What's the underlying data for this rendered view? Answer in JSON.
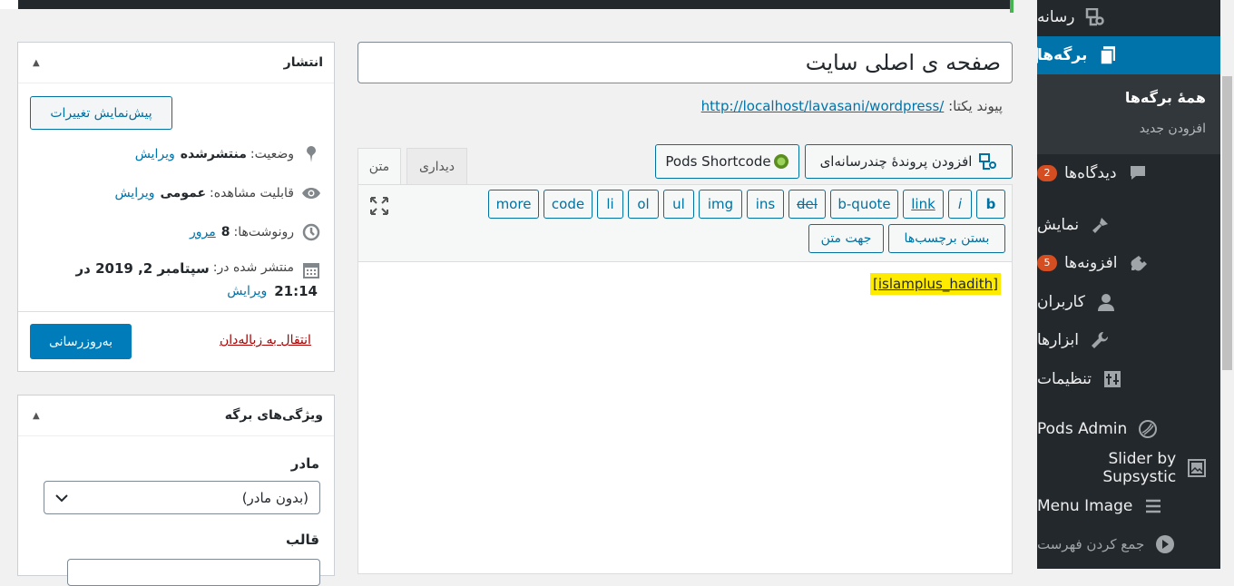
{
  "sidebar": {
    "items": [
      {
        "label": "رسانه",
        "icon": "media-icon"
      },
      {
        "label": "برگه‌ها",
        "icon": "pages-icon",
        "active": true
      },
      {
        "label": "دیدگاه‌ها",
        "icon": "comments-icon",
        "badge": "2"
      },
      {
        "label": "نمایش",
        "icon": "appearance-icon"
      },
      {
        "label": "افزونه‌ها",
        "icon": "plugins-icon",
        "badge": "5"
      },
      {
        "label": "کاربران",
        "icon": "users-icon"
      },
      {
        "label": "ابزارها",
        "icon": "tools-icon"
      },
      {
        "label": "تنظیمات",
        "icon": "settings-icon"
      },
      {
        "label": "Pods Admin",
        "icon": "pods-icon"
      },
      {
        "label": "Slider by Supsystic",
        "icon": "slider-icon"
      },
      {
        "label": "Menu Image",
        "icon": "menu-image-icon"
      },
      {
        "label": "جمع کردن فهرست",
        "icon": "collapse-icon"
      }
    ],
    "submenu": [
      "همهٔ برگه‌ها",
      "افزودن جدید"
    ]
  },
  "title": {
    "value": "صفحه ی اصلی سایت"
  },
  "permalink": {
    "label": "پیوند یکتا:",
    "url": "http://localhost/lavasani/wordpress/"
  },
  "media_buttons": {
    "add_media": "افزودن پروندهٔ چندرسانه‌ای",
    "pods": "Pods Shortcode"
  },
  "editor_tabs": {
    "visual": "دیداری",
    "text": "متن"
  },
  "quicktags": {
    "row1": [
      "b",
      "i",
      "link",
      "b-quote",
      "del",
      "ins",
      "img",
      "ul",
      "ol",
      "li",
      "code",
      "more"
    ],
    "row2": [
      "بستن برچسب‌ها",
      "جهت متن"
    ]
  },
  "editor_content": "[islamplus_hadith]",
  "publish": {
    "title": "انتشار",
    "preview_btn": "پیش‌نمایش تغییرات",
    "status_label": "وضعیت:",
    "status_value": "منتشرشده",
    "visibility_label": "قابلیت مشاهده:",
    "visibility_value": "عمومی",
    "revisions_label": "رونوشت‌ها:",
    "revisions_value": "8",
    "browse": "مرور",
    "published_label": "منتشر شده در:",
    "published_date": "سپتامبر 2, 2019 در",
    "published_time": "21:14",
    "edit": "ویرایش",
    "trash": "انتقال به زباله‌دان",
    "update": "به‌روزرسانی"
  },
  "page_attributes": {
    "title": "ویژگی‌های برگه",
    "parent_label": "مادر",
    "parent_value": "(بدون مادر)",
    "template_label": "قالب"
  },
  "colors": {
    "accent": "#0073aa",
    "sidebar": "#23282d",
    "badge": "#d54e21",
    "highlight": "#ffeb00"
  }
}
